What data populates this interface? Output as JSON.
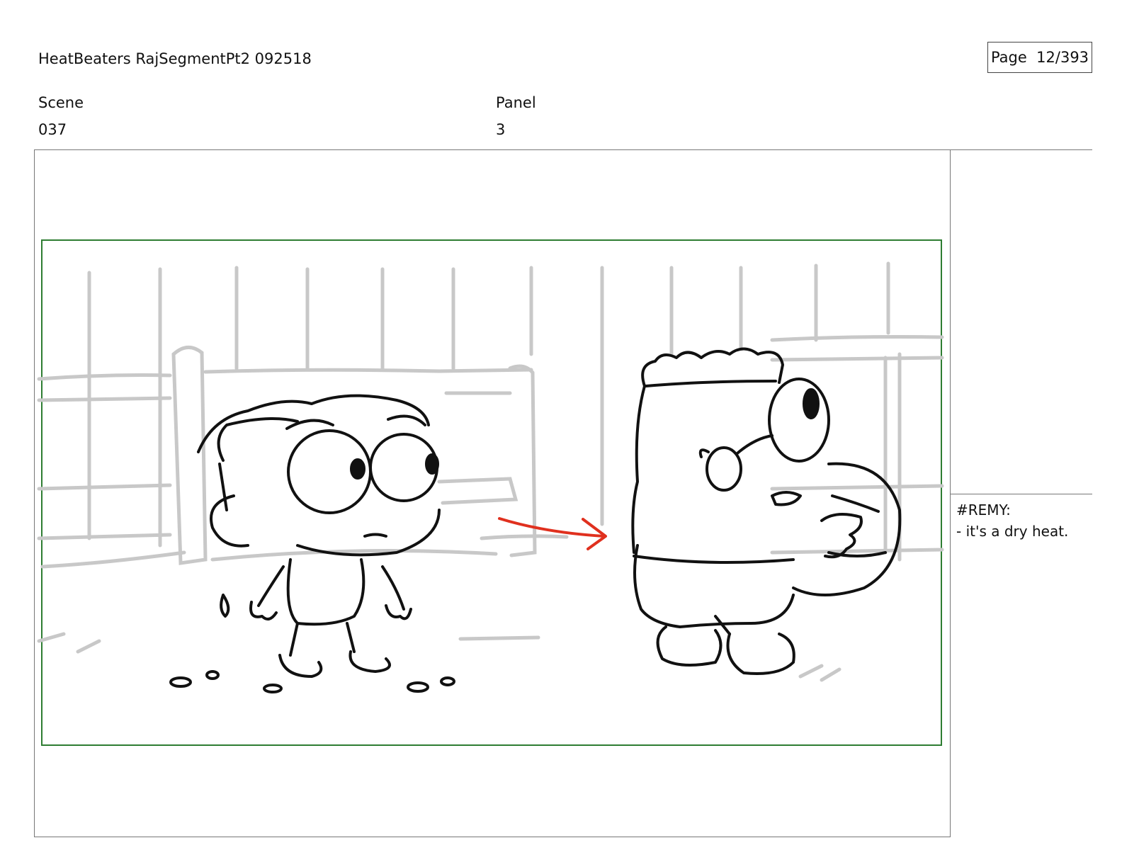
{
  "header": {
    "title": "HeatBeaters RajSegmentPt2 092518",
    "page_label": "Page",
    "page_number": "12/393"
  },
  "fields": {
    "scene_label": "Scene",
    "scene_value": "037",
    "panel_label": "Panel",
    "panel_value": "3"
  },
  "notes": {
    "speaker": "#REMY:",
    "line": "- it's a dry heat."
  },
  "colors": {
    "safe_area_border": "#2e7d32",
    "motion_arrow": "#e0301e",
    "background_sketch": "#c8c8c8",
    "ink": "#111111"
  }
}
